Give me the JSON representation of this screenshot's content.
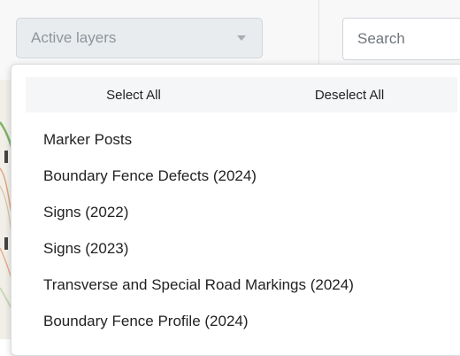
{
  "toolbar": {
    "layers_select_label": "Active layers",
    "search_placeholder": "Search"
  },
  "dropdown": {
    "select_all_label": "Select All",
    "deselect_all_label": "Deselect All",
    "layers": [
      "Marker Posts",
      "Boundary Fence Defects (2024)",
      "Signs (2022)",
      "Signs (2023)",
      "Transverse and Special Road Markings (2024)",
      "Boundary Fence Profile (2024)"
    ]
  },
  "colors": {
    "select_background": "#e9ecef",
    "placeholder_text": "#8e959c",
    "select_bar_background": "#f5f6f7",
    "map_background": "#f2efe9"
  }
}
